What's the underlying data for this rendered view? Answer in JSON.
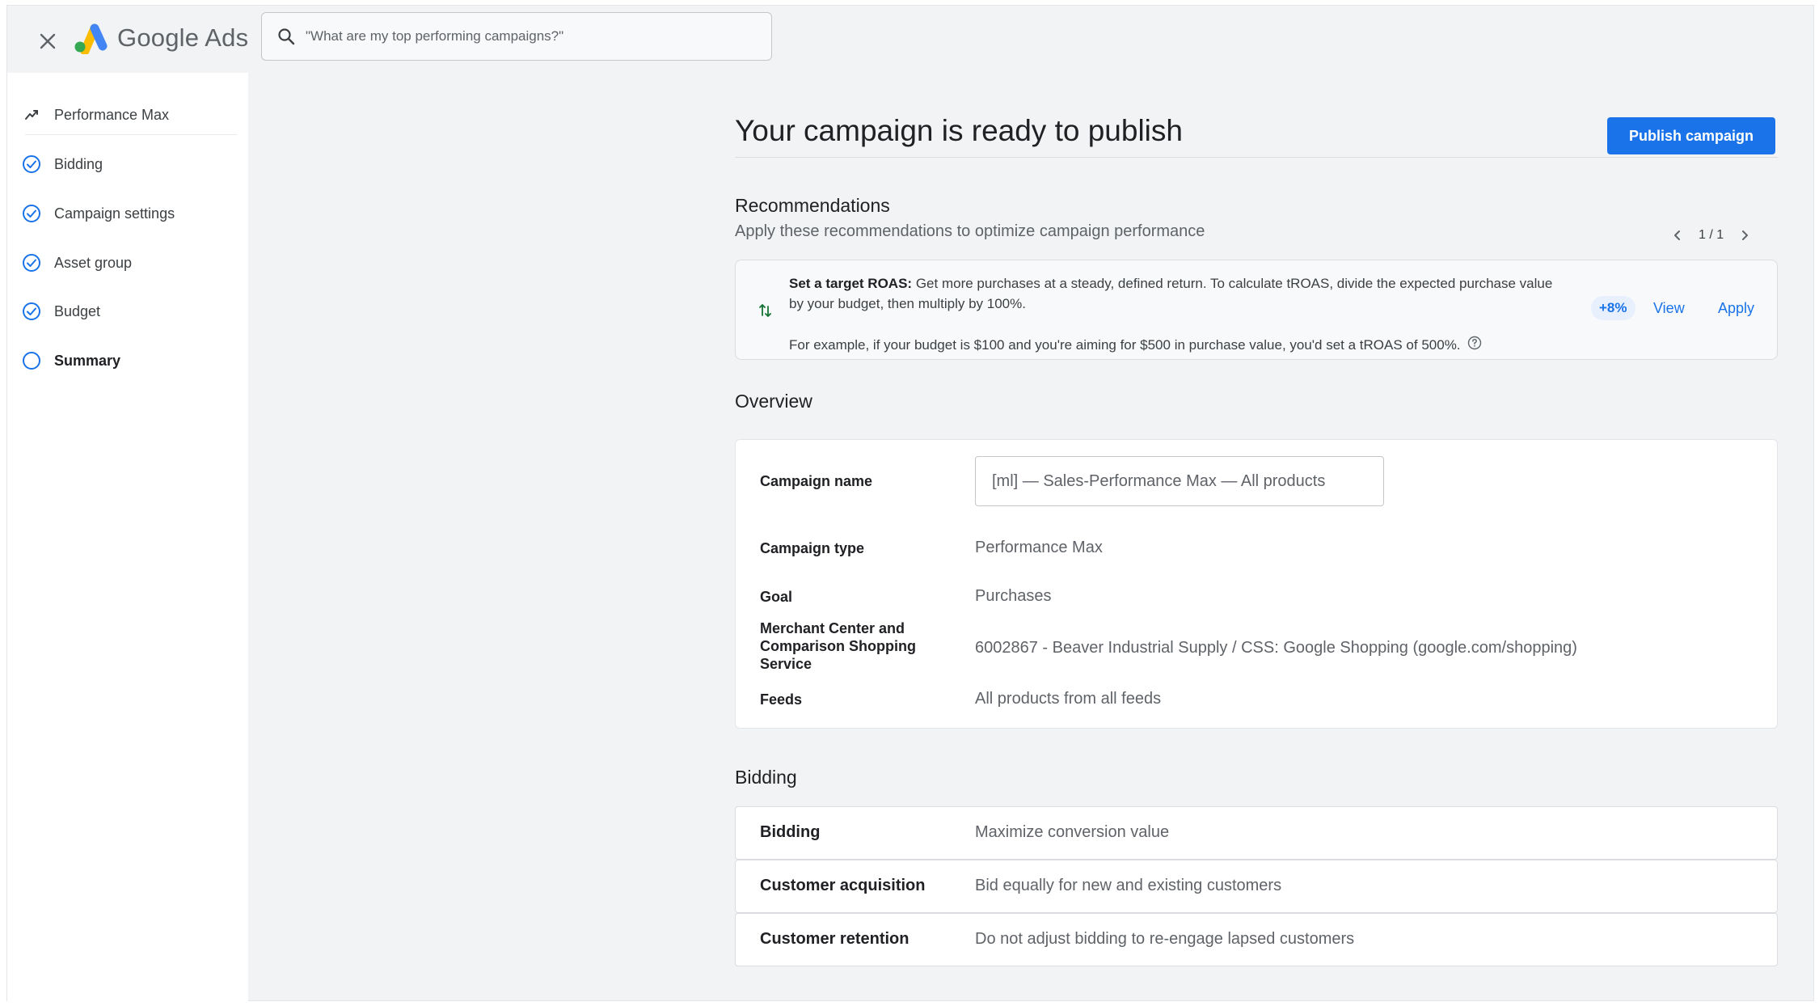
{
  "header": {
    "app_name": "Google Ads",
    "search_placeholder": "\"What are my top performing campaigns?\"",
    "icons": [
      "close-icon",
      "google-ads-logo",
      "search-icon"
    ]
  },
  "sidebar": {
    "items": [
      {
        "label": "Performance Max",
        "icon": "trending-icon",
        "state": "header"
      },
      {
        "label": "Bidding",
        "icon": "check-circle-icon",
        "state": "complete"
      },
      {
        "label": "Campaign settings",
        "icon": "check-circle-icon",
        "state": "complete"
      },
      {
        "label": "Asset group",
        "icon": "check-circle-icon",
        "state": "complete"
      },
      {
        "label": "Budget",
        "icon": "check-circle-icon",
        "state": "complete"
      },
      {
        "label": "Summary",
        "icon": "empty-circle-icon",
        "state": "active"
      }
    ]
  },
  "main": {
    "title": "Your campaign is ready to publish",
    "publish_label": "Publish campaign",
    "recommendations": {
      "heading": "Recommendations",
      "subheading": "Apply these recommendations to optimize campaign performance",
      "pager": "1 / 1",
      "card": {
        "title": "Set a target ROAS:",
        "body": "Get more purchases at a steady, defined return. To calculate tROAS, divide the expected purchase value by your budget, then multiply by 100%.",
        "example": "For example, if your budget is $100 and you're aiming for $500 in purchase value, you'd set a tROAS of 500%.",
        "uplift": "+8%",
        "view_label": "View",
        "apply_label": "Apply"
      }
    },
    "overview": {
      "heading": "Overview",
      "campaign_name_label": "Campaign name",
      "campaign_name_value": "[ml] — Sales-Performance Max — All products",
      "campaign_type_label": "Campaign type",
      "campaign_type_value": "Performance Max",
      "goal_label": "Goal",
      "goal_value": "Purchases",
      "merchant_label": "Merchant Center and Comparison Shopping Service",
      "merchant_value": "6002867 - Beaver Industrial Supply / CSS: Google Shopping (google.com/shopping)",
      "feeds_label": "Feeds",
      "feeds_value": "All products from all feeds"
    },
    "bidding": {
      "heading": "Bidding",
      "rows": [
        {
          "label": "Bidding",
          "value": "Maximize conversion value"
        },
        {
          "label": "Customer acquisition",
          "value": "Bid equally for new and existing customers"
        },
        {
          "label": "Customer retention",
          "value": "Do not adjust bidding to re-engage lapsed customers"
        }
      ]
    }
  },
  "colors": {
    "accent": "#1a73e8",
    "background": "#f1f3f4",
    "text_primary": "#202124",
    "text_secondary": "#5f6368"
  }
}
